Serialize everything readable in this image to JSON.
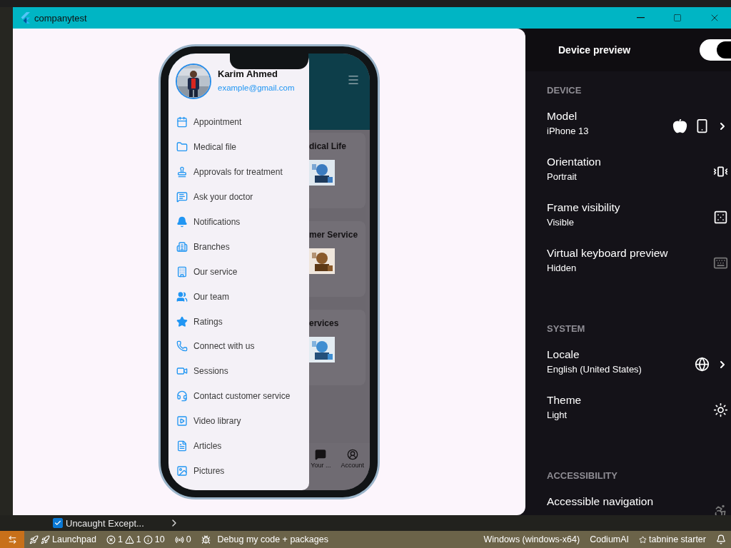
{
  "window": {
    "title": "companytest"
  },
  "phone": {
    "profile": {
      "name": "Karim Ahmed",
      "email": "example@gmail.com"
    },
    "menu": [
      {
        "label": "Appointment"
      },
      {
        "label": "Medical file"
      },
      {
        "label": "Approvals for treatment"
      },
      {
        "label": "Ask your doctor"
      },
      {
        "label": "Notifications"
      },
      {
        "label": "Branches"
      },
      {
        "label": "Our service"
      },
      {
        "label": "Our team"
      },
      {
        "label": "Ratings"
      },
      {
        "label": "Connect with us"
      },
      {
        "label": "Sessions"
      },
      {
        "label": "Contact customer service"
      },
      {
        "label": "Video library"
      },
      {
        "label": "Articles"
      },
      {
        "label": "Pictures"
      }
    ],
    "cards": [
      {
        "title": "dical Life"
      },
      {
        "title": "mer Service"
      },
      {
        "title": "ervices"
      }
    ],
    "nav": [
      {
        "label": "Your ..."
      },
      {
        "label": "Account"
      }
    ]
  },
  "panel": {
    "title": "Device preview",
    "toggle": {
      "on": true
    },
    "sections": [
      {
        "heading": "DEVICE",
        "items": [
          {
            "label": "Model",
            "value": "iPhone 13",
            "kind": "picker",
            "disabled": false
          },
          {
            "label": "Orientation",
            "value": "Portrait",
            "kind": "action",
            "disabled": false
          },
          {
            "label": "Frame visibility",
            "value": "Visible",
            "kind": "action",
            "disabled": false
          },
          {
            "label": "Virtual keyboard preview",
            "value": "Hidden",
            "kind": "action",
            "disabled": true
          }
        ]
      },
      {
        "heading": "SYSTEM",
        "items": [
          {
            "label": "Locale",
            "value": "English (United States)",
            "kind": "picker",
            "disabled": false
          },
          {
            "label": "Theme",
            "value": "Light",
            "kind": "action",
            "disabled": false
          }
        ]
      },
      {
        "heading": "ACCESSIBILITY",
        "items": [
          {
            "label": "Accessible navigation",
            "kind": "action",
            "disabled": true
          }
        ]
      }
    ]
  },
  "problems": {
    "label": "Uncaught Except...",
    "checked": true
  },
  "status_bar": {
    "launchpad": "Launchpad",
    "errors": "1",
    "warnings": "1",
    "infos": "10",
    "ports": "0",
    "debug": "Debug my code + packages",
    "platform": "Windows (windows-x64)",
    "codium": "CodiumAI",
    "tabnine": "tabnine starter"
  }
}
